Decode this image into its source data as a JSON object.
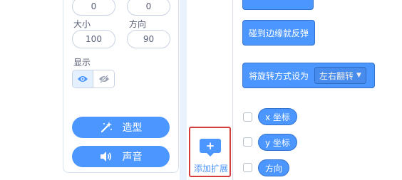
{
  "sprite_info": {
    "x_value": "0",
    "y_value": "0",
    "size_label": "大小",
    "size_value": "100",
    "direction_label": "方向",
    "direction_value": "90",
    "show_label": "显示"
  },
  "tabs": {
    "costumes_label": "造型",
    "sounds_label": "声音"
  },
  "extension": {
    "label": "添加扩展"
  },
  "blocks": {
    "bounce_label": "碰到边缘就反弹",
    "rotation_label": "将旋转方式设为",
    "rotation_value": "左右翻转"
  },
  "reporters": {
    "x_label": "x 坐标",
    "y_label": "y 坐标",
    "direction_label": "方向"
  },
  "colors": {
    "accent": "#4c97ff",
    "highlight": "#d63c3c"
  }
}
